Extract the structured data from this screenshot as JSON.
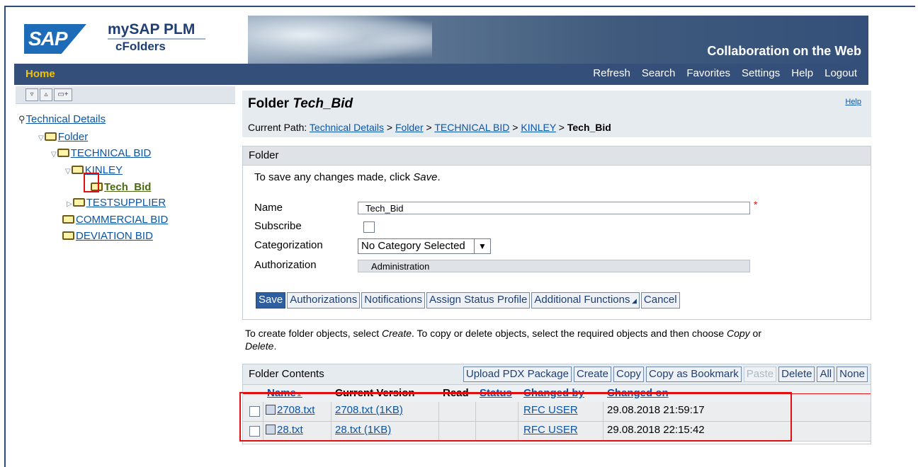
{
  "header": {
    "logo_text": "SAP",
    "product_line1": "mySAP PLM",
    "product_line2": "cFolders",
    "tagline": "Collaboration on the Web"
  },
  "nav": {
    "home": "Home",
    "links": [
      "Refresh",
      "Search",
      "Favorites",
      "Settings",
      "Help",
      "Logout"
    ]
  },
  "tree": {
    "root": "Technical Details",
    "folder": "Folder",
    "technical_bid": "TECHNICAL BID",
    "kinley": "KINLEY",
    "tech_bid": "Tech_Bid",
    "testsupplier": "TESTSUPPLIER",
    "commercial_bid": "COMMERCIAL BID",
    "deviation_bid": "DEVIATION BID"
  },
  "main": {
    "title_prefix": "Folder ",
    "title_name": "Tech_Bid",
    "help": "Help",
    "path_label": "Current Path: ",
    "path_links": [
      "Technical Details",
      "Folder",
      "TECHNICAL BID",
      "KINLEY"
    ],
    "path_sep": " > ",
    "path_current": "Tech_Bid"
  },
  "folder_panel": {
    "header": "Folder",
    "message_prefix": "To save any changes made, click ",
    "message_save": "Save",
    "message_suffix": ".",
    "name_label": "Name",
    "name_value": "Tech_Bid",
    "required_mark": "*",
    "subscribe_label": "Subscribe",
    "categorization_label": "Categorization",
    "categorization_value": "No Category Selected",
    "authorization_label": "Authorization",
    "authorization_value": "Administration",
    "buttons": [
      "Save",
      "Authorizations",
      "Notifications",
      "Assign Status Profile",
      "Additional Functions",
      "Cancel"
    ]
  },
  "info": {
    "text1": "To create folder objects, select ",
    "create": "Create",
    "text2": ". To copy or delete objects, select the required objects and then choose ",
    "copy": "Copy",
    "text3": " or ",
    "delete": "Delete",
    "text4": "."
  },
  "contents": {
    "title": "Folder Contents",
    "buttons": [
      "Upload PDX Package",
      "Create",
      "Copy",
      "Copy as Bookmark",
      "Paste",
      "Delete",
      "All",
      "None"
    ],
    "columns": [
      "Name",
      "Current Version",
      "Read",
      "Status",
      "Changed by",
      "Changed on"
    ],
    "rows": [
      {
        "name": "2708.txt",
        "version": "2708.txt (1KB)",
        "read": "",
        "status": "",
        "changed_by": "RFC USER",
        "changed_on": "29.08.2018 21:59:17"
      },
      {
        "name": "28.txt",
        "version": "28.txt (1KB)",
        "read": "",
        "status": "",
        "changed_by": "RFC USER",
        "changed_on": "29.08.2018 22:15:42"
      }
    ]
  },
  "colors": {
    "nav_bg": "#34507a",
    "home_text": "#f2c200",
    "link": "#0a55a6",
    "highlight_box": "#e01010"
  }
}
